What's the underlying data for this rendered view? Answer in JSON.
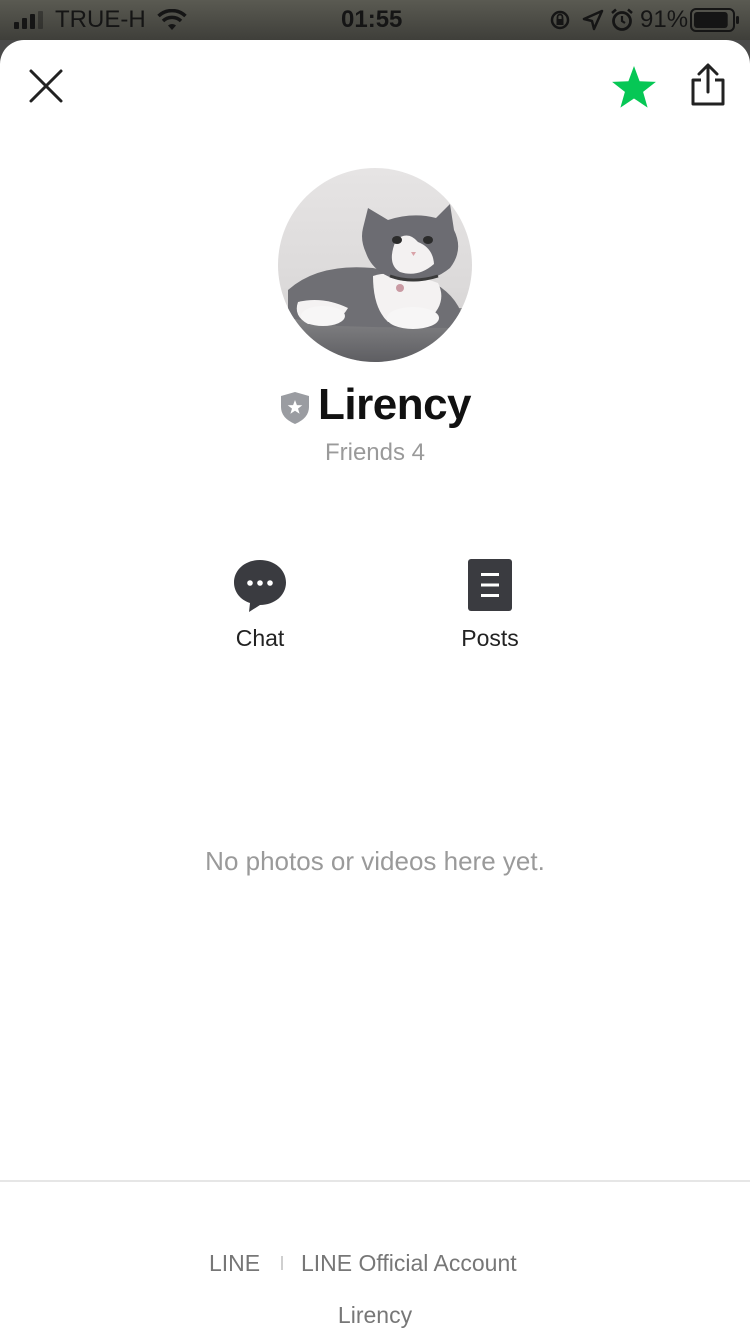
{
  "status_bar": {
    "carrier": "TRUE-H",
    "time": "01:55",
    "battery_percent": "91%",
    "battery_level": 0.91
  },
  "toolbar": {
    "close_icon": "close-icon",
    "favorite_icon": "star-icon",
    "share_icon": "share-icon",
    "accent_color": "#06c755"
  },
  "profile": {
    "name": "Lirency",
    "friends": "Friends 4",
    "badge_icon": "shield-star-icon"
  },
  "actions": [
    {
      "label": "Chat",
      "icon": "chat-bubble-icon"
    },
    {
      "label": "Posts",
      "icon": "posts-icon"
    }
  ],
  "media": {
    "empty_message": "No photos or videos here yet."
  },
  "footer": {
    "link_line": "LINE",
    "link_official": "LINE Official Account",
    "account_name": "Lirency"
  }
}
